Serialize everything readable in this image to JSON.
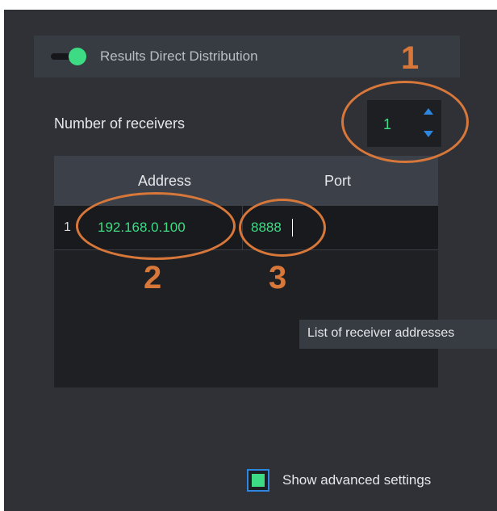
{
  "header": {
    "toggle_on": true,
    "label": "Results Direct Distribution"
  },
  "receivers": {
    "label": "Number of receivers",
    "count": "1"
  },
  "table": {
    "columns": [
      "Address",
      "Port"
    ],
    "rows": [
      {
        "index": "1",
        "address": "192.168.0.100",
        "port": "8888"
      }
    ]
  },
  "tooltip": "List of receiver addresses",
  "advanced": {
    "label": "Show advanced settings",
    "checked": true
  },
  "annotations": {
    "marker_1": "1",
    "marker_2": "2",
    "marker_3": "3"
  },
  "colors": {
    "accent_green": "#3ddc84",
    "accent_blue": "#2d86e0",
    "annotation_orange": "#d8773a",
    "panel_bg": "#2f3136"
  }
}
